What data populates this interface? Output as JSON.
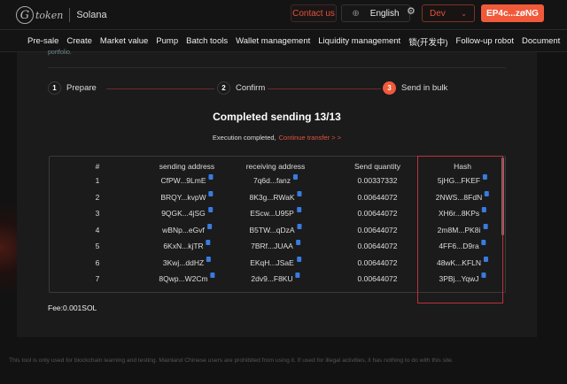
{
  "header": {
    "logo_text": "token",
    "chain": "Solana",
    "contact": "Contact us",
    "language": "English",
    "network": "Dev",
    "wallet": "EP4c...zøNG"
  },
  "nav": [
    "Pre-sale",
    "Create",
    "Market value",
    "Pump",
    "Batch tools",
    "Wallet management",
    "Liquidity management",
    "锁(开发中)",
    "Follow-up robot",
    "Document"
  ],
  "page": {
    "portfolio_text": "portfolio.",
    "steps": [
      {
        "num": "1",
        "label": "Prepare"
      },
      {
        "num": "2",
        "label": "Confirm"
      },
      {
        "num": "3",
        "label": "Send in bulk"
      }
    ],
    "title": "Completed sending 13/13",
    "status": "Execution completed,",
    "continue_link": "Continue transfer > >",
    "fee": "Fee:0.001SOL"
  },
  "table": {
    "headers": [
      "#",
      "sending address",
      "receiving address",
      "Send quantity",
      "Hash"
    ],
    "rows": [
      [
        "1",
        "CfPW...9LmE",
        "7q6d...fanz",
        "0.00337332",
        "5jHG...FKEF"
      ],
      [
        "2",
        "BRQY...kvpW",
        "8K3g...RWaK",
        "0.00644072",
        "2NWS...8FdN"
      ],
      [
        "3",
        "9QGK...4jSG",
        "EScw...U95P",
        "0.00644072",
        "XH6r...8KPs"
      ],
      [
        "4",
        "wBNp...eGvf",
        "B5TW...qDzA",
        "0.00644072",
        "2m8M...PK8i"
      ],
      [
        "5",
        "6KxN...kjTR",
        "7BRf...JUAA",
        "0.00644072",
        "4FF6...D9ra"
      ],
      [
        "6",
        "3Kwj...ddHZ",
        "EKqH...JSaE",
        "0.00644072",
        "48wK...KFLN"
      ],
      [
        "7",
        "8Qwp...W2Cm",
        "2dv9...F8KU",
        "0.00644072",
        "3PBj...YqwJ"
      ]
    ]
  },
  "footer": "This tool is only used for blockchain learning and testing. Mainland Chinese users are prohibited from using it. If used for illegal activities, it has nothing to do with this site.",
  "colors": {
    "accent": "#f05a3a",
    "highlight_box": "#c0303a",
    "copy_icon": "#3a7be0"
  }
}
